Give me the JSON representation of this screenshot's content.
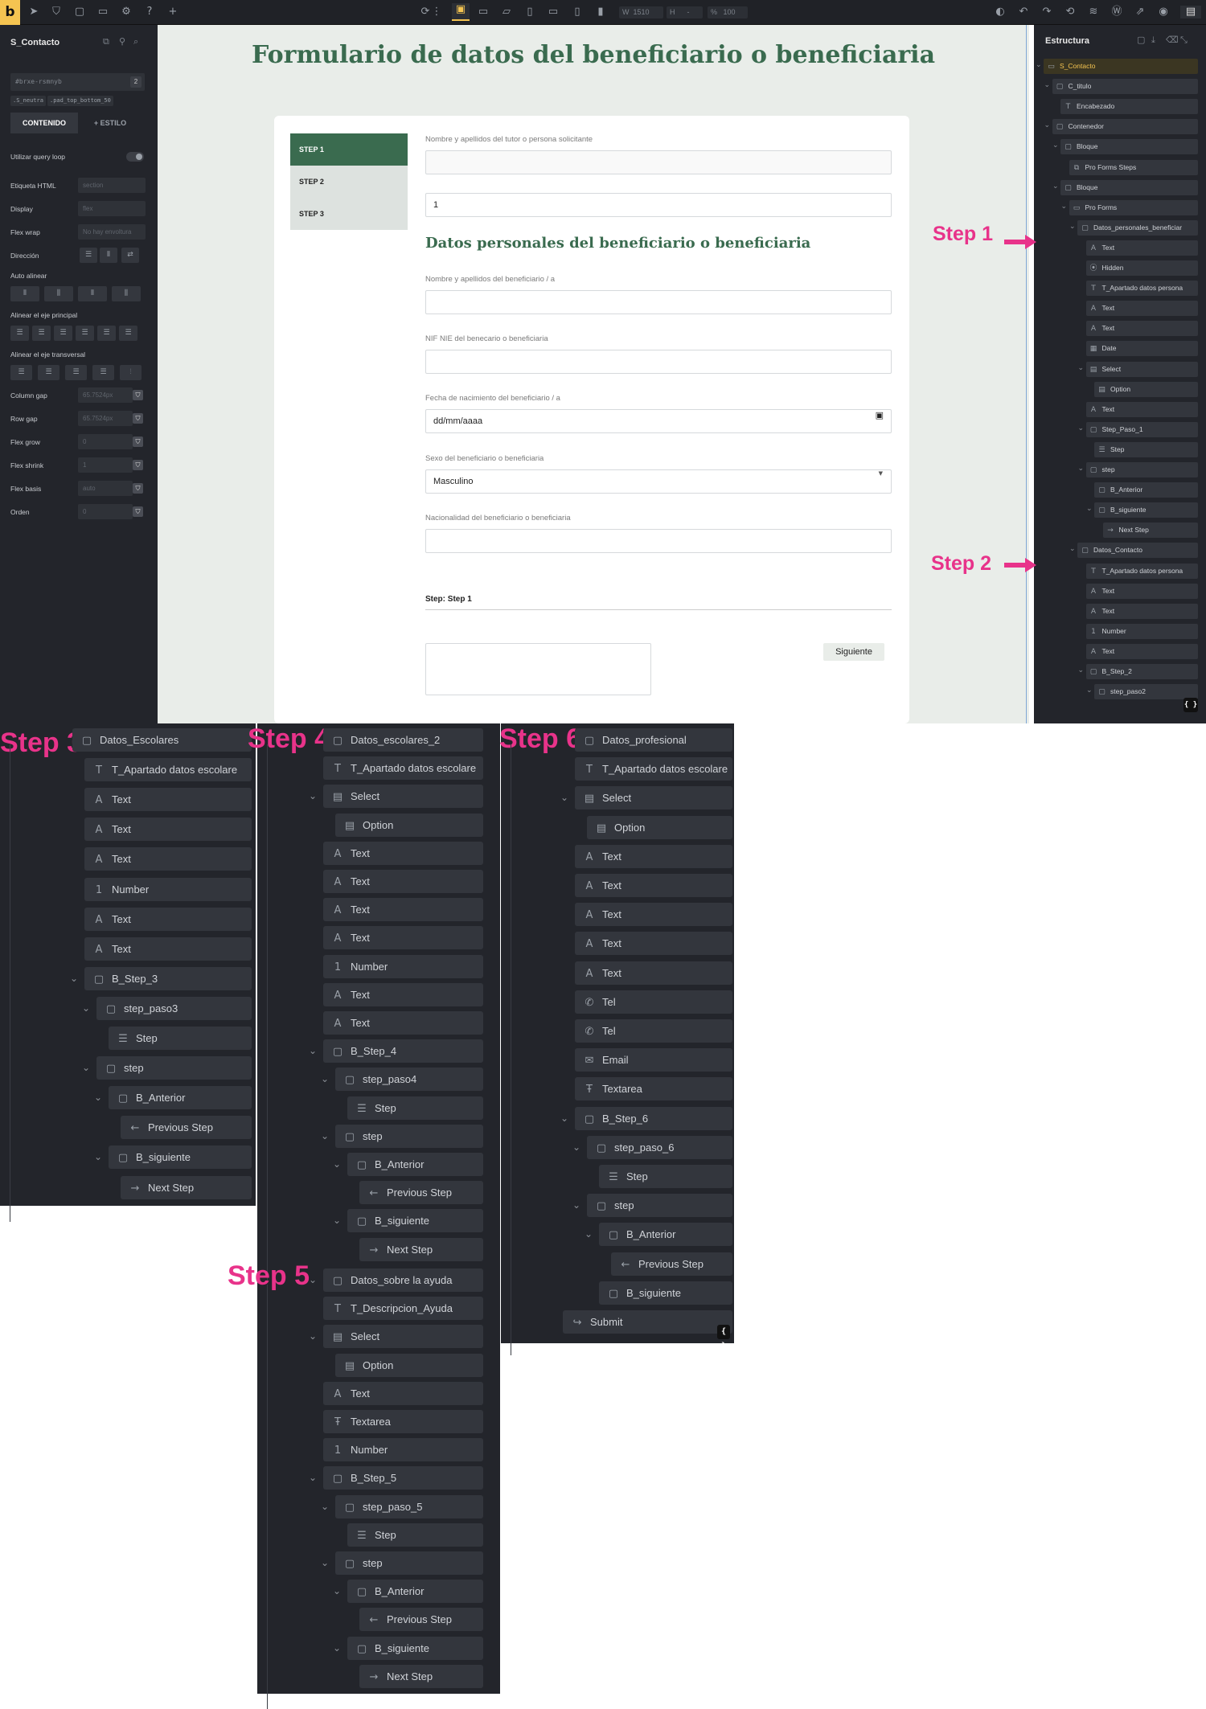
{
  "toolbar": {
    "logo": "b",
    "width_label": "W",
    "width_value": "1510",
    "height_label": "H",
    "height_value": "-",
    "zoom_label": "%",
    "zoom_value": "100"
  },
  "left_panel": {
    "title": "S_Contacto",
    "element_id": "#brxe-rsmnyb",
    "id_badge": "2",
    "classes": [
      ".S_neutra",
      ".pad_top_bottom_50"
    ],
    "tabs": [
      "CONTENIDO",
      "+ ESTILO"
    ],
    "query_loop": "Utilizar query loop",
    "fields": [
      {
        "label": "Etiqueta HTML",
        "value": "section"
      },
      {
        "label": "Display",
        "value": "flex"
      },
      {
        "label": "Flex wrap",
        "value": "No hay envoltura"
      },
      {
        "label": "Dirección"
      },
      {
        "label": "Auto alinear"
      },
      {
        "label": "Alinear el eje principal"
      },
      {
        "label": "Alinear el eje transversal"
      },
      {
        "label": "Column gap",
        "value": "65.7524px"
      },
      {
        "label": "Row gap",
        "value": "65.7524px"
      },
      {
        "label": "Flex grow",
        "value": "0"
      },
      {
        "label": "Flex shrink",
        "value": "1"
      },
      {
        "label": "Flex basis",
        "value": "auto"
      },
      {
        "label": "Orden",
        "value": "0"
      }
    ]
  },
  "canvas": {
    "title": "Formulario de datos del beneficiario o beneficiaria",
    "steps": [
      "STEP 1",
      "STEP 2",
      "STEP 3"
    ],
    "tutor_label": "Nombre y apellidos del tutor o persona solicitante",
    "hidden_value": "1",
    "section_title": "Datos personales del beneficiario o beneficiaria",
    "name_label": "Nombre y apellidos del beneficiario / a",
    "nif_label": "NIF NIE del benecario o beneficiaria",
    "birth_label": "Fecha de nacimiento del beneficiario / a",
    "birth_placeholder": "dd/mm/aaaa",
    "sex_label": "Sexo del beneficiario o beneficiaria",
    "sex_value": "Masculino",
    "nationality_label": "Nacionalidad del beneficiario o beneficiaria",
    "step_label": "Step: Step 1",
    "next_button": "Siguiente"
  },
  "right_panel": {
    "title": "Estructura",
    "code_icon": "{ }",
    "nodes": [
      "S_Contacto",
      "C_titulo",
      "Encabezado",
      "Contenedor",
      "Bloque",
      "Pro Forms Steps",
      "Bloque",
      "Pro Forms",
      "Datos_personales_beneficiar",
      "Text",
      "Hidden",
      "T_Apartado datos persona",
      "Text",
      "Text",
      "Date",
      "Select",
      "Option",
      "Text",
      "Step_Paso_1",
      "Step",
      "step",
      "B_Anterior",
      "B_siguiente",
      "Next Step",
      "Datos_Contacto",
      "T_Apartado datos persona",
      "Text",
      "Text",
      "Number",
      "Text",
      "B_Step_2",
      "step_paso2"
    ]
  },
  "annotations": {
    "step1": "Step 1",
    "step2": "Step 2",
    "step3": "Step 3",
    "step4": "Step 4",
    "step5": "Step 5",
    "step6": "Step 6"
  },
  "lower": {
    "step3": [
      "Datos_Escolares",
      "T_Apartado datos escolare",
      "Text",
      "Text",
      "Text",
      "Number",
      "Text",
      "Text",
      "B_Step_3",
      "step_paso3",
      "Step",
      "step",
      "B_Anterior",
      "Previous Step",
      "B_siguiente",
      "Next Step"
    ],
    "step4": [
      "Datos_escolares_2",
      "T_Apartado datos escolare",
      "Select",
      "Option",
      "Text",
      "Text",
      "Text",
      "Text",
      "Number",
      "Text",
      "Text",
      "B_Step_4",
      "step_paso4",
      "Step",
      "step",
      "B_Anterior",
      "Previous Step",
      "B_siguiente",
      "Next Step"
    ],
    "step5": [
      "Datos_sobre la ayuda",
      "T_Descripcion_Ayuda",
      "Select",
      "Option",
      "Text",
      "Textarea",
      "Number",
      "B_Step_5",
      "step_paso_5",
      "Step",
      "step",
      "B_Anterior",
      "Previous Step",
      "B_siguiente",
      "Next Step"
    ],
    "step6": [
      "Datos_profesional",
      "T_Apartado datos escolare",
      "Select",
      "Option",
      "Text",
      "Text",
      "Text",
      "Text",
      "Text",
      "Tel",
      "Tel",
      "Email",
      "Textarea",
      "B_Step_6",
      "step_paso_6",
      "Step",
      "step",
      "B_Anterior",
      "Previous Step",
      "B_siguiente",
      "Submit"
    ],
    "code_icon": "{ }"
  },
  "colors": {
    "accent": "#3a6b4f",
    "annotation": "#e8338a",
    "panel": "#23252b",
    "highlight": "#f5c451"
  }
}
